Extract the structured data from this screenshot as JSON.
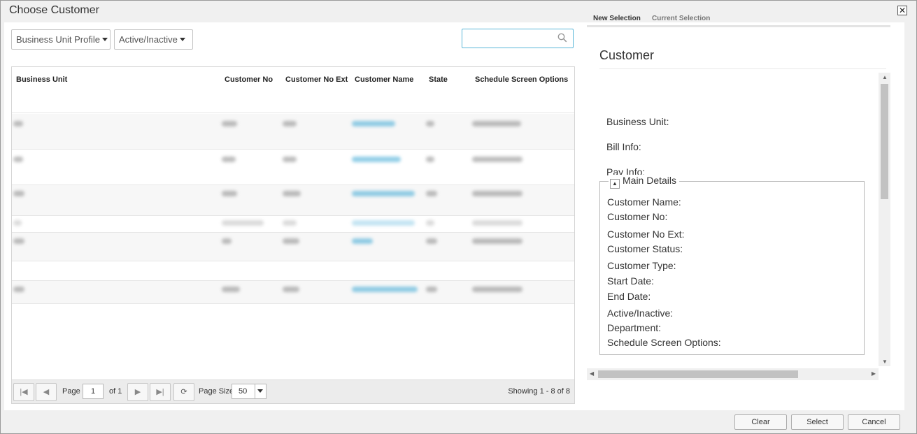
{
  "dialog": {
    "title": "Choose Customer"
  },
  "toolbar": {
    "filter_business_unit": "Business Unit Profile",
    "filter_active": "Active/Inactive",
    "search_value": ""
  },
  "grid": {
    "columns": [
      "Business Unit",
      "Customer No",
      "Customer No Ext",
      "Customer Name",
      "State",
      "Schedule Screen Options"
    ]
  },
  "pager": {
    "page_label": "Page",
    "page_value": "1",
    "of_label": "of 1",
    "page_size_label": "Page Size",
    "page_size_value": "50",
    "showing": "Showing 1 - 8 of 8"
  },
  "tabs": {
    "new_selection": "New Selection",
    "current_selection": "Current Selection"
  },
  "details": {
    "title": "Customer",
    "business_unit": "Business Unit:",
    "bill_info": "Bill Info:",
    "pay_info": "Pay Info:",
    "main_details": {
      "legend": "Main Details",
      "toggle_glyph": "▲",
      "fields": [
        "Customer Name:",
        "Customer No:",
        "Customer No Ext:",
        "Customer Status:",
        "Customer Type:",
        "Start Date:",
        "End Date:",
        "Active/Inactive:",
        "Department:",
        "Schedule Screen Options:"
      ]
    }
  },
  "footer": {
    "clear": "Clear",
    "select": "Select",
    "cancel": "Cancel"
  },
  "colors": {
    "accent": "#3ba7d4",
    "title_text": "#333333",
    "border": "#c4c4c4"
  }
}
